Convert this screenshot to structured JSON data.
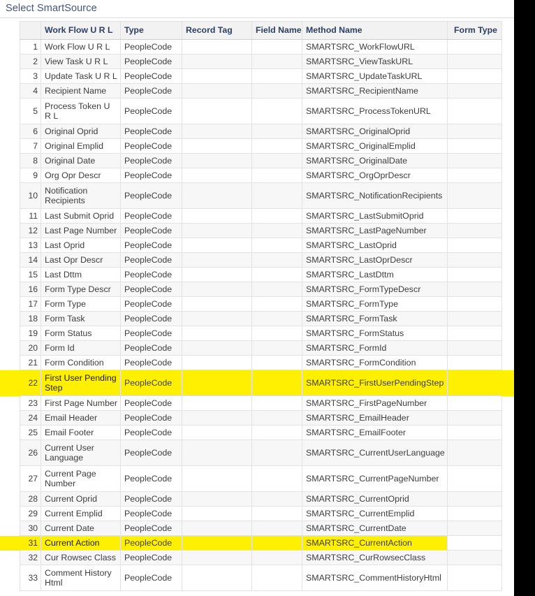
{
  "page": {
    "title": "Select SmartSource"
  },
  "grid": {
    "columns": [
      {
        "key": "num",
        "label": "",
        "align": "right"
      },
      {
        "key": "name",
        "label": "Work Flow U R L",
        "align": "left"
      },
      {
        "key": "type",
        "label": "Type",
        "align": "left"
      },
      {
        "key": "rtag",
        "label": "Record Tag",
        "align": "left"
      },
      {
        "key": "fname",
        "label": "Field Name",
        "align": "left"
      },
      {
        "key": "mname",
        "label": "Method Name",
        "align": "left"
      },
      {
        "key": "ftype",
        "label": "Form Type",
        "align": "right"
      }
    ],
    "highlight_color": "#ffef00",
    "rows": [
      {
        "num": "1",
        "name": "Work Flow U R L",
        "type": "PeopleCode",
        "rtag": "",
        "fname": "",
        "mname": "SMARTSRC_WorkFlowURL",
        "ftype": "",
        "highlight": "none"
      },
      {
        "num": "2",
        "name": "View Task U R L",
        "type": "PeopleCode",
        "rtag": "",
        "fname": "",
        "mname": "SMARTSRC_ViewTaskURL",
        "ftype": "",
        "highlight": "none"
      },
      {
        "num": "3",
        "name": "Update Task U R L",
        "type": "PeopleCode",
        "rtag": "",
        "fname": "",
        "mname": "SMARTSRC_UpdateTaskURL",
        "ftype": "",
        "highlight": "none"
      },
      {
        "num": "4",
        "name": "Recipient Name",
        "type": "PeopleCode",
        "rtag": "",
        "fname": "",
        "mname": "SMARTSRC_RecipientName",
        "ftype": "",
        "highlight": "none"
      },
      {
        "num": "5",
        "name": "Process Token U R L",
        "type": "PeopleCode",
        "rtag": "",
        "fname": "",
        "mname": "SMARTSRC_ProcessTokenURL",
        "ftype": "",
        "highlight": "none"
      },
      {
        "num": "6",
        "name": "Original Oprid",
        "type": "PeopleCode",
        "rtag": "",
        "fname": "",
        "mname": "SMARTSRC_OriginalOprid",
        "ftype": "",
        "highlight": "none"
      },
      {
        "num": "7",
        "name": "Original Emplid",
        "type": "PeopleCode",
        "rtag": "",
        "fname": "",
        "mname": "SMARTSRC_OriginalEmplid",
        "ftype": "",
        "highlight": "none"
      },
      {
        "num": "8",
        "name": "Original Date",
        "type": "PeopleCode",
        "rtag": "",
        "fname": "",
        "mname": "SMARTSRC_OriginalDate",
        "ftype": "",
        "highlight": "none"
      },
      {
        "num": "9",
        "name": "Org Opr Descr",
        "type": "PeopleCode",
        "rtag": "",
        "fname": "",
        "mname": "SMARTSRC_OrgOprDescr",
        "ftype": "",
        "highlight": "none"
      },
      {
        "num": "10",
        "name": "Notification Recipients",
        "type": "PeopleCode",
        "rtag": "",
        "fname": "",
        "mname": "SMARTSRC_NotificationRecipients",
        "ftype": "",
        "highlight": "none"
      },
      {
        "num": "11",
        "name": "Last Submit Oprid",
        "type": "PeopleCode",
        "rtag": "",
        "fname": "",
        "mname": "SMARTSRC_LastSubmitOprid",
        "ftype": "",
        "highlight": "none"
      },
      {
        "num": "12",
        "name": "Last Page Number",
        "type": "PeopleCode",
        "rtag": "",
        "fname": "",
        "mname": "SMARTSRC_LastPageNumber",
        "ftype": "",
        "highlight": "none"
      },
      {
        "num": "13",
        "name": "Last Oprid",
        "type": "PeopleCode",
        "rtag": "",
        "fname": "",
        "mname": "SMARTSRC_LastOprid",
        "ftype": "",
        "highlight": "none"
      },
      {
        "num": "14",
        "name": "Last Opr Descr",
        "type": "PeopleCode",
        "rtag": "",
        "fname": "",
        "mname": "SMARTSRC_LastOprDescr",
        "ftype": "",
        "highlight": "none"
      },
      {
        "num": "15",
        "name": "Last Dttm",
        "type": "PeopleCode",
        "rtag": "",
        "fname": "",
        "mname": "SMARTSRC_LastDttm",
        "ftype": "",
        "highlight": "none"
      },
      {
        "num": "16",
        "name": "Form Type Descr",
        "type": "PeopleCode",
        "rtag": "",
        "fname": "",
        "mname": "SMARTSRC_FormTypeDescr",
        "ftype": "",
        "highlight": "none"
      },
      {
        "num": "17",
        "name": "Form Type",
        "type": "PeopleCode",
        "rtag": "",
        "fname": "",
        "mname": "SMARTSRC_FormType",
        "ftype": "",
        "highlight": "none"
      },
      {
        "num": "18",
        "name": "Form Task",
        "type": "PeopleCode",
        "rtag": "",
        "fname": "",
        "mname": "SMARTSRC_FormTask",
        "ftype": "",
        "highlight": "none"
      },
      {
        "num": "19",
        "name": "Form Status",
        "type": "PeopleCode",
        "rtag": "",
        "fname": "",
        "mname": "SMARTSRC_FormStatus",
        "ftype": "",
        "highlight": "none"
      },
      {
        "num": "20",
        "name": "Form Id",
        "type": "PeopleCode",
        "rtag": "",
        "fname": "",
        "mname": "SMARTSRC_FormId",
        "ftype": "",
        "highlight": "none"
      },
      {
        "num": "21",
        "name": "Form Condition",
        "type": "PeopleCode",
        "rtag": "",
        "fname": "",
        "mname": "SMARTSRC_FormCondition",
        "ftype": "",
        "highlight": "none"
      },
      {
        "num": "22",
        "name": "First User Pending Step",
        "type": "PeopleCode",
        "rtag": "",
        "fname": "",
        "mname": "SMARTSRC_FirstUserPendingStep",
        "ftype": "",
        "highlight": "full"
      },
      {
        "num": "23",
        "name": "First Page Number",
        "type": "PeopleCode",
        "rtag": "",
        "fname": "",
        "mname": "SMARTSRC_FirstPageNumber",
        "ftype": "",
        "highlight": "none"
      },
      {
        "num": "24",
        "name": "Email Header",
        "type": "PeopleCode",
        "rtag": "",
        "fname": "",
        "mname": "SMARTSRC_EmailHeader",
        "ftype": "",
        "highlight": "none"
      },
      {
        "num": "25",
        "name": "Email Footer",
        "type": "PeopleCode",
        "rtag": "",
        "fname": "",
        "mname": "SMARTSRC_EmailFooter",
        "ftype": "",
        "highlight": "none"
      },
      {
        "num": "26",
        "name": "Current User Language",
        "type": "PeopleCode",
        "rtag": "",
        "fname": "",
        "mname": "SMARTSRC_CurrentUserLanguage",
        "ftype": "",
        "highlight": "none"
      },
      {
        "num": "27",
        "name": "Current Page Number",
        "type": "PeopleCode",
        "rtag": "",
        "fname": "",
        "mname": "SMARTSRC_CurrentPageNumber",
        "ftype": "",
        "highlight": "none"
      },
      {
        "num": "28",
        "name": "Current Oprid",
        "type": "PeopleCode",
        "rtag": "",
        "fname": "",
        "mname": "SMARTSRC_CurrentOprid",
        "ftype": "",
        "highlight": "none"
      },
      {
        "num": "29",
        "name": "Current Emplid",
        "type": "PeopleCode",
        "rtag": "",
        "fname": "",
        "mname": "SMARTSRC_CurrentEmplid",
        "ftype": "",
        "highlight": "none"
      },
      {
        "num": "30",
        "name": "Current Date",
        "type": "PeopleCode",
        "rtag": "",
        "fname": "",
        "mname": "SMARTSRC_CurrentDate",
        "ftype": "",
        "highlight": "none"
      },
      {
        "num": "31",
        "name": "Current Action",
        "type": "PeopleCode",
        "rtag": "",
        "fname": "",
        "mname": "SMARTSRC_CurrentAction",
        "ftype": "",
        "highlight": "partial"
      },
      {
        "num": "32",
        "name": "Cur Rowsec Class",
        "type": "PeopleCode",
        "rtag": "",
        "fname": "",
        "mname": "SMARTSRC_CurRowsecClass",
        "ftype": "",
        "highlight": "none"
      },
      {
        "num": "33",
        "name": "Comment History Html",
        "type": "PeopleCode",
        "rtag": "",
        "fname": "",
        "mname": "SMARTSRC_CommentHistoryHtml",
        "ftype": "",
        "highlight": "none"
      }
    ]
  }
}
